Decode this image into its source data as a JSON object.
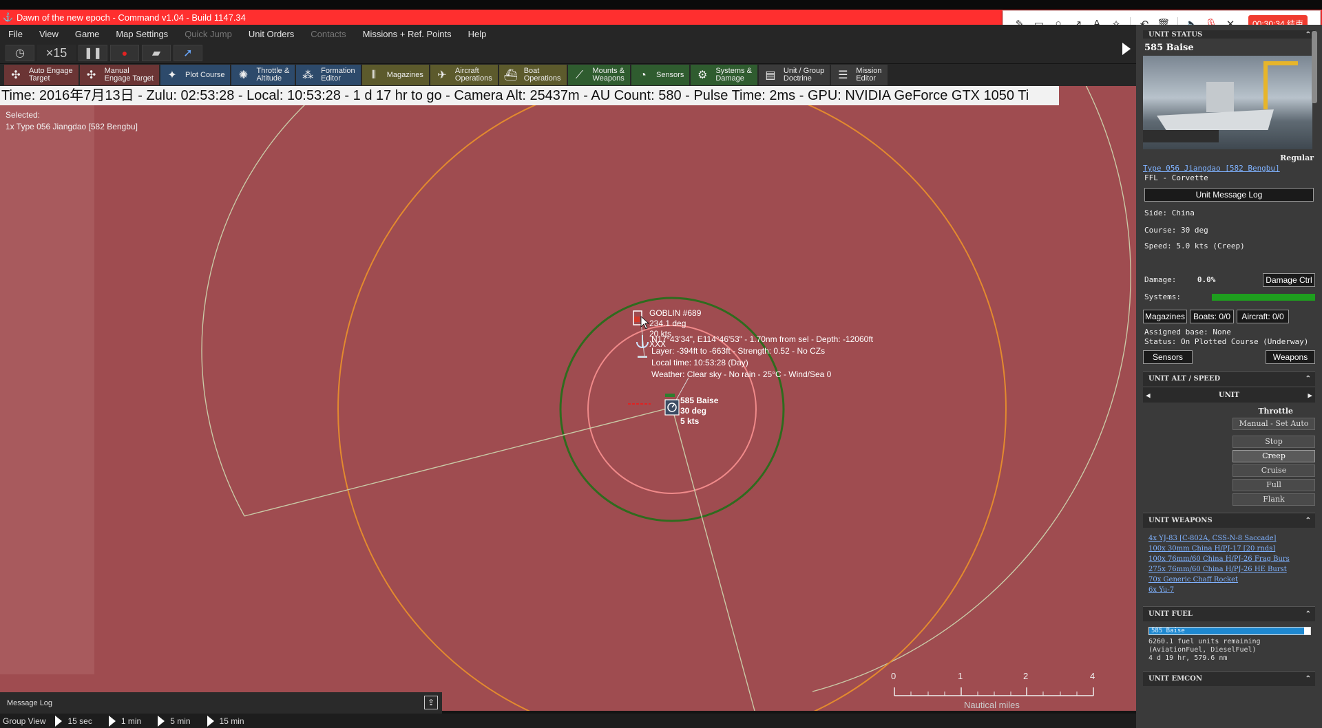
{
  "window": {
    "title": "Dawn of the new epoch - Command v1.04 - Build 1147.34"
  },
  "capture_toolbar": {
    "timer": "00:30:34 结束"
  },
  "menu": [
    "File",
    "View",
    "Game",
    "Map Settings",
    "Quick Jump",
    "Unit Orders",
    "Contacts",
    "Missions + Ref. Points",
    "Help"
  ],
  "menu_disabled": [
    "Quick Jump",
    "Contacts"
  ],
  "controls": {
    "speed": "×15"
  },
  "toolbar": [
    {
      "label1": "Auto Engage",
      "label2": "Target",
      "color": "red",
      "icon": "target-icon"
    },
    {
      "label1": "Manual",
      "label2": "Engage Target",
      "color": "red",
      "icon": "target-icon"
    },
    {
      "label1": "Plot Course",
      "label2": "",
      "color": "blue",
      "icon": "compass-icon"
    },
    {
      "label1": "Throttle &",
      "label2": "Altitude",
      "color": "blue",
      "icon": "gauge-icon"
    },
    {
      "label1": "Formation",
      "label2": "Editor",
      "color": "blue",
      "icon": "formation-icon"
    },
    {
      "label1": "Magazines",
      "label2": "",
      "color": "olive",
      "icon": "ammo-icon"
    },
    {
      "label1": "Aircraft",
      "label2": "Operations",
      "color": "olive",
      "icon": "aircraft-icon"
    },
    {
      "label1": "Boat",
      "label2": "Operations",
      "color": "olive",
      "icon": "boat-icon"
    },
    {
      "label1": "Mounts &",
      "label2": "Weapons",
      "color": "green",
      "icon": "weapons-icon"
    },
    {
      "label1": "Sensors",
      "label2": "",
      "color": "green",
      "icon": "radar-icon"
    },
    {
      "label1": "Systems &",
      "label2": "Damage",
      "color": "green",
      "icon": "gear-icon"
    },
    {
      "label1": "Unit / Group",
      "label2": "Doctrine",
      "color": "grey",
      "icon": "document-icon"
    },
    {
      "label1": "Mission",
      "label2": "Editor",
      "color": "grey",
      "icon": "list-icon"
    }
  ],
  "status": {
    "line": "Time: 2016年7月13日 - Zulu: 02:53:28 - Local: 10:53:28 - 1 d 17 hr to go -  Camera Alt: 25437m  - AU Count: 580 - Pulse Time: 2ms - GPU: NVIDIA GeForce GTX 1050 Ti"
  },
  "selection": {
    "title": "Selected:",
    "item": "1x Type 056 Jiangdao [582 Bengbu]"
  },
  "map_labels": {
    "contact_name": "GOBLIN #689",
    "contact_course": "234.1 deg",
    "contact_speed": "20 kts",
    "contact_xxx": "XXX",
    "hover_pos": "N17°43'34\", E114°46'53\" - 1.70nm from sel - Depth: -12060ft",
    "hover_layer": "Layer: -394ft to -663ft - Strength: 0.52 - No CZs",
    "hover_time": "Local time: 10:53:28 (Day)",
    "hover_weather": "Weather: Clear sky - No rain - 25°C - Wind/Sea 0",
    "unit_name": "585 Baise",
    "unit_course": "30 deg",
    "unit_speed": "5 kts"
  },
  "scale": {
    "ticks": [
      "0",
      "1",
      "2",
      "4"
    ],
    "unit": "Nautical miles"
  },
  "message_log": {
    "label": "Message Log"
  },
  "time_steps": {
    "group_view": "Group View",
    "steps": [
      "15 sec",
      "1 min",
      "5 min",
      "15 min"
    ]
  },
  "side_panel": {
    "unit_name": "585 Baise",
    "proficiency": "Regular",
    "class_link": "Type 056 Jiangdao [582 Bengbu]",
    "type": "FFL - Corvette",
    "message_log_btn": "Unit Message Log",
    "side": "Side: China",
    "course": "Course: 30 deg",
    "speed": "Speed: 5.0 kts (Creep)",
    "damage_label": "Damage:",
    "damage_value": "0.0%",
    "damage_ctrl": "Damage Ctrl",
    "systems_label": "Systems:",
    "magazines_btn": "Magazines",
    "boats_btn": "Boats: 0/0",
    "aircraft_btn": "Aircraft: 0/0",
    "assigned_base": "Assigned base: None",
    "status": "Status: On Plotted Course (Underway)",
    "sensors_btn": "Sensors",
    "weapons_btn": "Weapons",
    "alt_speed_head": "UNIT ALT / SPEED",
    "unit_tab": "UNIT",
    "throttle_label": "Throttle",
    "manual_btn": "Manual - Set Auto",
    "throttle_options": [
      "Stop",
      "Creep",
      "Cruise",
      "Full",
      "Flank"
    ],
    "throttle_active": "Creep",
    "weapons_head": "UNIT WEAPONS",
    "weapons": [
      "4x YJ-83 [C-802A, CSS-N-8 Saccade]",
      "100x 30mm China H/PJ-17 [20 rnds]",
      "100x 76mm/60 China H/PJ-26 Frag Burs",
      "275x 76mm/60 China H/PJ-26 HE Burst",
      "70x Generic Chaff Rocket",
      "6x Yu-7"
    ],
    "fuel_head": "UNIT FUEL",
    "fuel_bar_label": "585 Baise",
    "fuel_fraction": 0.96,
    "fuel_line1": "6260.1 fuel units remaining",
    "fuel_line2": "(AviationFuel, DieselFuel)",
    "fuel_line3": "4 d 19 hr, 579.6 nm",
    "emcon_head": "UNIT EMCON",
    "status_head": "UNIT STATUS"
  },
  "colors": {
    "map_bg": "#9f4c50",
    "title_bar": "#ff2f2f",
    "orange_ring": "#e38a2e",
    "green_ring": "#2f6b1e",
    "pink_ring": "#f08a8a",
    "range_arc": "#c9c9a6"
  }
}
